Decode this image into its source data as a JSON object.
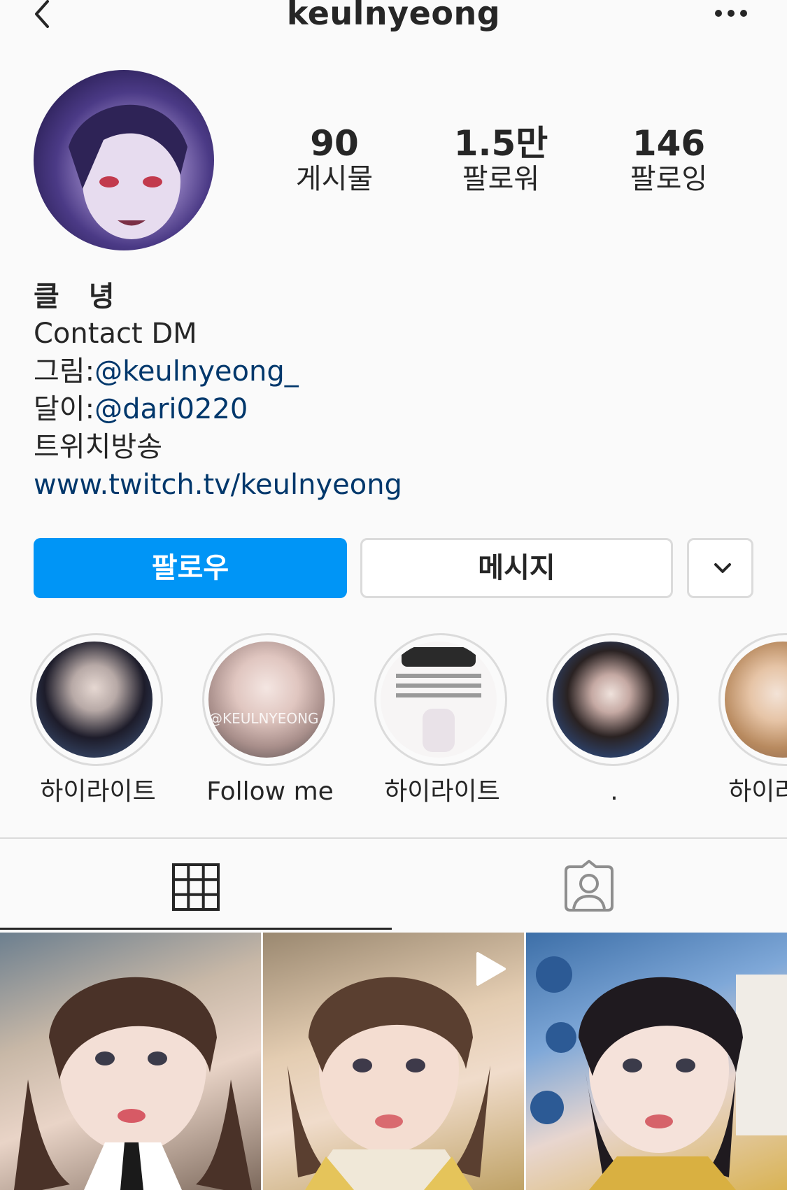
{
  "header": {
    "username": "keulnyeong",
    "back_icon": "chevron-left-icon",
    "more_icon": "more-horizontal-icon"
  },
  "profile": {
    "stats": [
      {
        "value": "90",
        "label": "게시물"
      },
      {
        "value": "1.5만",
        "label": "팔로워"
      },
      {
        "value": "146",
        "label": "팔로잉"
      }
    ],
    "name": "클 녕",
    "bio": {
      "line1": "Contact DM",
      "line2_prefix": "그림:",
      "line2_mention": "@keulnyeong_",
      "line3_prefix": "달이:",
      "line3_mention": "@dari0220",
      "line4": "트위치방송",
      "link": "www.twitch.tv/keulnyeong"
    }
  },
  "buttons": {
    "follow": "팔로우",
    "message": "메시지",
    "dropdown_icon": "chevron-down-icon"
  },
  "highlights": [
    {
      "label": "하이라이트"
    },
    {
      "label": "Follow me",
      "overlay_text": "@KEULNYEONG_"
    },
    {
      "label": "하이라이트"
    },
    {
      "label": "."
    },
    {
      "label": "하이라이트"
    }
  ],
  "tabs": {
    "grid_icon": "grid-icon",
    "tagged_icon": "tagged-person-icon"
  },
  "colors": {
    "accent": "#0095f6",
    "link": "#00376b",
    "border": "#dbdbdb",
    "background": "#fafafa",
    "text": "#262626"
  }
}
